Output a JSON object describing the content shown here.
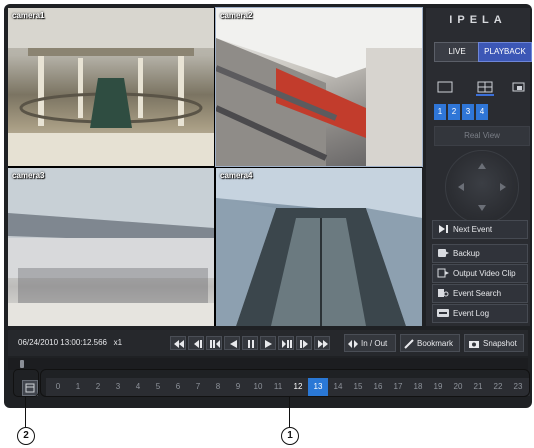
{
  "brand": "IPELA",
  "modes": {
    "live": "LIVE",
    "playback": "PLAYBACK"
  },
  "cameras": [
    {
      "label": "camera1"
    },
    {
      "label": "camera2"
    },
    {
      "label": "camera3"
    },
    {
      "label": "camera4"
    }
  ],
  "channel_tabs": [
    "1",
    "2",
    "3",
    "4"
  ],
  "real_view": "Real View",
  "actions": {
    "next_event": "Next Event",
    "backup": "Backup",
    "output_video_clip": "Output Video Clip",
    "event_search": "Event Search",
    "event_log": "Event Log"
  },
  "transport": {
    "datetime": "06/24/2010 13:00:12.566",
    "speed": "x1",
    "in_out": "In / Out",
    "bookmark": "Bookmark",
    "snapshot": "Snapshot"
  },
  "hours": [
    "0",
    "1",
    "2",
    "3",
    "4",
    "5",
    "6",
    "7",
    "8",
    "9",
    "10",
    "11",
    "12",
    "13",
    "14",
    "15",
    "16",
    "17",
    "18",
    "19",
    "20",
    "21",
    "22",
    "23"
  ],
  "hours_with_recording": [
    "12",
    "13"
  ],
  "current_hour": "13",
  "callouts": {
    "hour_bar": "1",
    "day_selector": "2"
  },
  "colors": {
    "accent": "#2a78d6",
    "playback": "#3c57b6",
    "panel": "#1f2124"
  }
}
